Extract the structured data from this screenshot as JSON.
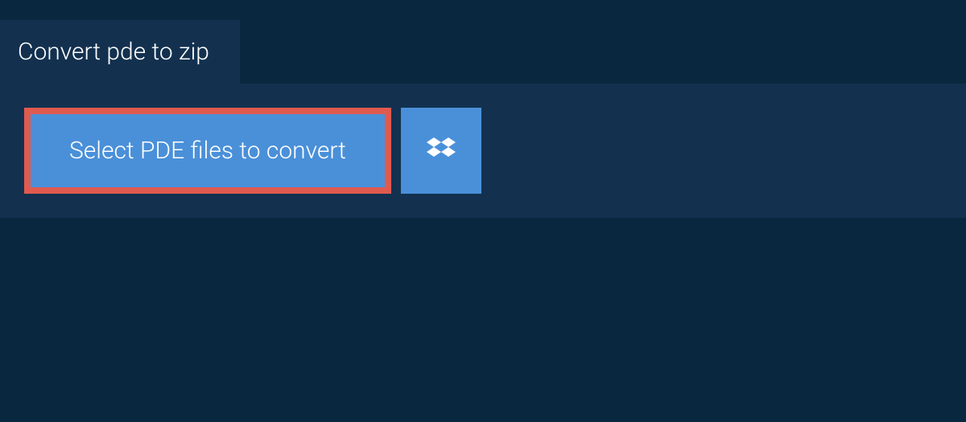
{
  "tab": {
    "label": "Convert pde to zip"
  },
  "actions": {
    "select_files_label": "Select PDE files to convert"
  }
}
